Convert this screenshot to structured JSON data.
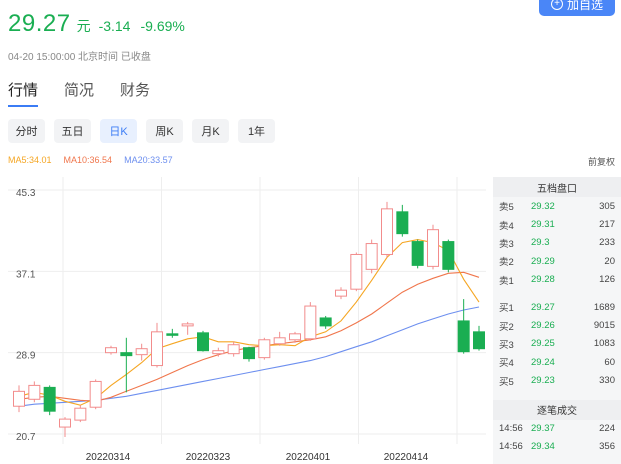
{
  "quote": {
    "price": "29.27",
    "unit": "元",
    "change": "-3.14",
    "change_pct": "-9.69%",
    "timestamp": "04-20 15:00:00 北京时间 已收盘"
  },
  "add_button": {
    "label": "加自选"
  },
  "tabs": [
    {
      "label": "行情",
      "active": true
    },
    {
      "label": "简况"
    },
    {
      "label": "财务"
    }
  ],
  "periods": [
    {
      "label": "分时"
    },
    {
      "label": "五日"
    },
    {
      "label": "日K",
      "active": true
    },
    {
      "label": "周K"
    },
    {
      "label": "月K"
    },
    {
      "label": "1年"
    }
  ],
  "ma_legend": {
    "ma5": "MA5:34.01",
    "ma10": "MA10:36.54",
    "ma20": "MA20:33.57"
  },
  "adjust_label": "前复权",
  "colors": {
    "up": "#f28c8c",
    "down": "#1aae52",
    "ma5": "#f5a623",
    "ma10": "#f0764c",
    "ma20": "#6d8fef",
    "accent": "#3b7cf5"
  },
  "order_book": {
    "title": "五档盘口",
    "asks": [
      {
        "label": "卖5",
        "price": "29.32",
        "volume": "305"
      },
      {
        "label": "卖4",
        "price": "29.31",
        "volume": "217"
      },
      {
        "label": "卖3",
        "price": "29.3",
        "volume": "233"
      },
      {
        "label": "卖2",
        "price": "29.29",
        "volume": "20"
      },
      {
        "label": "卖1",
        "price": "29.28",
        "volume": "126"
      }
    ],
    "bids": [
      {
        "label": "买1",
        "price": "29.27",
        "volume": "1689"
      },
      {
        "label": "买2",
        "price": "29.26",
        "volume": "9015"
      },
      {
        "label": "买3",
        "price": "29.25",
        "volume": "1083"
      },
      {
        "label": "买4",
        "price": "29.24",
        "volume": "60"
      },
      {
        "label": "买5",
        "price": "29.23",
        "volume": "330"
      }
    ]
  },
  "trades": {
    "title": "逐笔成交",
    "rows": [
      {
        "time": "14:56",
        "price": "29.37",
        "volume": "224"
      },
      {
        "time": "14:56",
        "price": "29.34",
        "volume": "356"
      }
    ]
  },
  "chart_data": {
    "type": "candlestick",
    "y_ticks": [
      "45.3",
      "37.1",
      "28.9",
      "20.7"
    ],
    "x_ticks": [
      "20220314",
      "20220323",
      "20220401",
      "20220414"
    ],
    "ylim": [
      20.7,
      45.3
    ],
    "candles": [
      {
        "o": 23.5,
        "c": 25.0,
        "h": 25.6,
        "l": 22.9
      },
      {
        "o": 24.2,
        "c": 25.6,
        "h": 26.0,
        "l": 23.9
      },
      {
        "o": 25.4,
        "c": 23.0,
        "h": 25.6,
        "l": 22.6
      },
      {
        "o": 21.4,
        "c": 22.2,
        "h": 22.4,
        "l": 20.4
      },
      {
        "o": 22.1,
        "c": 23.3,
        "h": 23.6,
        "l": 21.9
      },
      {
        "o": 23.4,
        "c": 26.0,
        "h": 26.2,
        "l": 23.2
      },
      {
        "o": 28.9,
        "c": 29.4,
        "h": 29.6,
        "l": 28.7
      },
      {
        "o": 28.9,
        "c": 28.6,
        "h": 30.4,
        "l": 24.9
      },
      {
        "o": 28.7,
        "c": 29.3,
        "h": 29.8,
        "l": 28.1
      },
      {
        "o": 27.6,
        "c": 31.0,
        "h": 31.9,
        "l": 27.4
      },
      {
        "o": 30.8,
        "c": 30.7,
        "h": 31.3,
        "l": 30.4
      },
      {
        "o": 31.6,
        "c": 31.8,
        "h": 32.0,
        "l": 30.7
      },
      {
        "o": 30.9,
        "c": 29.1,
        "h": 31.1,
        "l": 29.0
      },
      {
        "o": 28.8,
        "c": 29.1,
        "h": 29.4,
        "l": 28.5
      },
      {
        "o": 28.8,
        "c": 29.7,
        "h": 30.0,
        "l": 28.5
      },
      {
        "o": 29.4,
        "c": 28.3,
        "h": 29.5,
        "l": 28.0
      },
      {
        "o": 28.4,
        "c": 30.2,
        "h": 30.4,
        "l": 28.2
      },
      {
        "o": 29.8,
        "c": 30.4,
        "h": 31.0,
        "l": 29.6
      },
      {
        "o": 30.2,
        "c": 30.8,
        "h": 31.0,
        "l": 29.9
      },
      {
        "o": 30.3,
        "c": 33.6,
        "h": 34.0,
        "l": 30.1
      },
      {
        "o": 32.4,
        "c": 31.6,
        "h": 32.6,
        "l": 31.3
      },
      {
        "o": 34.6,
        "c": 35.2,
        "h": 35.5,
        "l": 34.3
      },
      {
        "o": 35.3,
        "c": 38.8,
        "h": 39.0,
        "l": 35.1
      },
      {
        "o": 37.3,
        "c": 39.9,
        "h": 40.3,
        "l": 36.9
      },
      {
        "o": 38.8,
        "c": 43.4,
        "h": 44.1,
        "l": 38.5
      },
      {
        "o": 43.1,
        "c": 40.9,
        "h": 43.8,
        "l": 40.6
      },
      {
        "o": 40.1,
        "c": 37.7,
        "h": 40.3,
        "l": 37.4
      },
      {
        "o": 37.6,
        "c": 41.3,
        "h": 41.8,
        "l": 37.3
      },
      {
        "o": 40.1,
        "c": 37.3,
        "h": 40.3,
        "l": 37.0
      },
      {
        "o": 32.1,
        "c": 29.0,
        "h": 34.3,
        "l": 28.8
      },
      {
        "o": 31.0,
        "c": 29.3,
        "h": 31.6,
        "l": 29.1
      }
    ],
    "ma5": [
      24.5,
      24.9,
      24.6,
      24.0,
      23.6,
      24.3,
      25.6,
      26.7,
      27.9,
      29.3,
      29.8,
      30.3,
      30.5,
      30.0,
      30.0,
      29.7,
      29.6,
      29.7,
      29.6,
      30.5,
      31.0,
      32.1,
      34.0,
      36.2,
      38.5,
      40.0,
      40.3,
      40.0,
      39.2,
      36.3,
      34.0
    ],
    "ma10": [
      24.2,
      24.4,
      24.5,
      24.3,
      24.1,
      24.0,
      24.4,
      25.0,
      25.6,
      26.2,
      26.9,
      27.6,
      28.2,
      28.7,
      29.1,
      29.4,
      29.6,
      29.8,
      30.0,
      30.2,
      30.5,
      31.1,
      31.9,
      32.8,
      33.9,
      35.0,
      35.8,
      36.4,
      36.9,
      37.0,
      36.5
    ],
    "ma20": [
      23.5,
      23.7,
      23.8,
      23.9,
      24.0,
      24.1,
      24.3,
      24.5,
      24.8,
      25.1,
      25.4,
      25.7,
      26.0,
      26.3,
      26.6,
      26.9,
      27.2,
      27.5,
      27.8,
      28.1,
      28.5,
      29.0,
      29.5,
      30.0,
      30.6,
      31.2,
      31.8,
      32.3,
      32.8,
      33.2,
      33.5
    ]
  }
}
